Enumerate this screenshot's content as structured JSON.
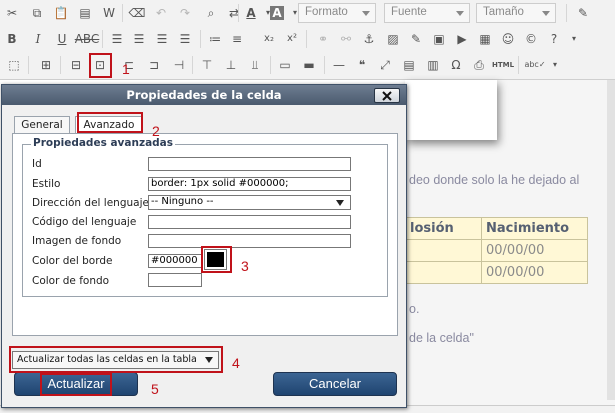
{
  "toolbar": {
    "format_placeholder": "Formato",
    "font_placeholder": "Fuente",
    "size_placeholder": "Tamaño"
  },
  "icons": [
    "cut-icon",
    "copy-icon",
    "paste-icon",
    "paste-text-icon",
    "paste-word-icon",
    "remove-format-icon",
    "undo-icon",
    "redo-icon",
    "find-icon",
    "replace-icon",
    "text-color-icon",
    "background-color-icon",
    "bold-icon",
    "italic-icon",
    "underline-icon",
    "strikethrough-icon",
    "align-left-icon",
    "align-center-icon",
    "align-right-icon",
    "align-justify-icon",
    "subscript-icon",
    "superscript-icon",
    "link-icon",
    "unlink-icon",
    "anchor-icon",
    "image-icon",
    "media-icon",
    "youtube-icon",
    "embed-icon",
    "emoticon-icon",
    "special-char-icon",
    "help-icon",
    "table-icon",
    "cell-properties-icon",
    "html-icon",
    "spellcheck-icon"
  ],
  "editor": {
    "text_line1": "deo donde solo la he dejado al",
    "table_headers": [
      "losión",
      "Nacimiento"
    ],
    "table_rows": [
      [
        "",
        "00/00/00"
      ],
      [
        "",
        "00/00/00"
      ]
    ],
    "text_line2": "o.",
    "text_line3": "de la celda\""
  },
  "dialog": {
    "title": "Propiedades de la celda",
    "tabs": [
      "General",
      "Avanzado"
    ],
    "active_tab": "Avanzado",
    "legend": "Propiedades avanzadas",
    "fields": {
      "id": {
        "label": "Id",
        "value": ""
      },
      "style": {
        "label": "Estilo",
        "value": "border: 1px solid #000000;"
      },
      "dir": {
        "label": "Dirección del lenguaje",
        "value": "-- Ninguno --"
      },
      "lang": {
        "label": "Código del lenguaje",
        "value": ""
      },
      "bgimage": {
        "label": "Imagen de fondo",
        "value": ""
      },
      "bordercolor": {
        "label": "Color del borde",
        "value": "#000000"
      },
      "bgcolor": {
        "label": "Color de fondo",
        "value": ""
      }
    },
    "apply_option": "Actualizar todas las celdas en la tabla",
    "update_button": "Actualizar",
    "cancel_button": "Cancelar"
  },
  "annotations": [
    "1",
    "2",
    "3",
    "4",
    "5"
  ],
  "colors": {
    "annotation_red": "#c0121a",
    "dialog_title_bg": "#4a5a6e",
    "button_blue": "#1f4470",
    "table_cell_bg": "#fff8d6",
    "border_color_swatch": "#000000"
  }
}
